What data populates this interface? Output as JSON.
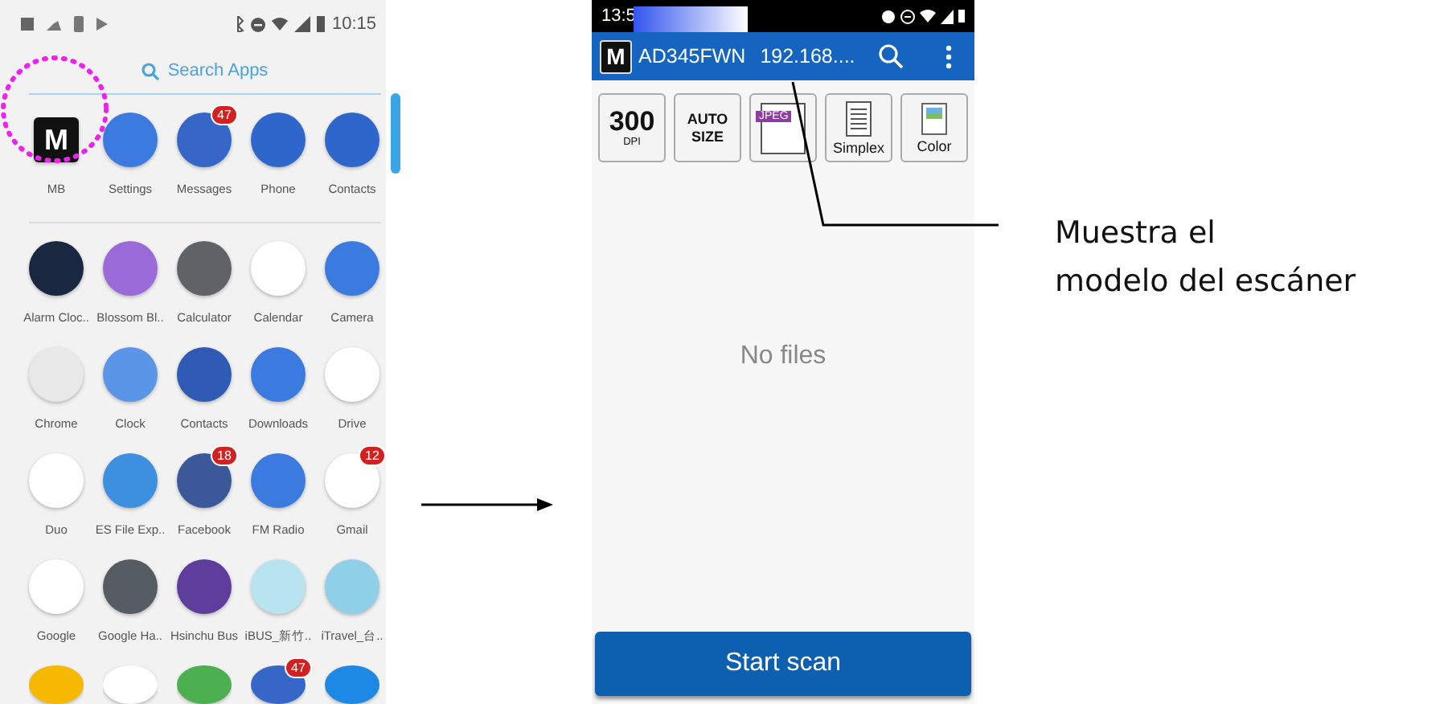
{
  "left_phone": {
    "status_bar": {
      "time": "10:15"
    },
    "search": {
      "placeholder": "Search Apps"
    },
    "favorites": [
      {
        "label": "MB",
        "logo": "M"
      },
      {
        "label": "Settings"
      },
      {
        "label": "Messages",
        "badge": "47"
      },
      {
        "label": "Phone"
      },
      {
        "label": "Contacts"
      }
    ],
    "apps": [
      {
        "label": "Alarm Cloc.."
      },
      {
        "label": "Blossom Bl.."
      },
      {
        "label": "Calculator"
      },
      {
        "label": "Calendar"
      },
      {
        "label": "Camera"
      },
      {
        "label": "Chrome"
      },
      {
        "label": "Clock"
      },
      {
        "label": "Contacts"
      },
      {
        "label": "Downloads"
      },
      {
        "label": "Drive"
      },
      {
        "label": "Duo"
      },
      {
        "label": "ES File Exp.."
      },
      {
        "label": "Facebook",
        "badge": "18"
      },
      {
        "label": "FM Radio"
      },
      {
        "label": "Gmail",
        "badge": "12"
      },
      {
        "label": "Google"
      },
      {
        "label": "Google Ha.."
      },
      {
        "label": "Hsinchu Bus"
      },
      {
        "label": "iBUS_新竹.."
      },
      {
        "label": "iTravel_台.."
      },
      {
        "kind": "partial"
      },
      {
        "kind": "partial"
      },
      {
        "kind": "partial"
      },
      {
        "kind": "partial",
        "badge": "47"
      },
      {
        "kind": "partial"
      }
    ]
  },
  "right_phone": {
    "status_bar": {
      "time": "13:5"
    },
    "toolbar": {
      "logo": "M",
      "model": "AD345FWN",
      "address": "192.168...."
    },
    "options": [
      {
        "kind": "dpi",
        "lines": [
          "300",
          "DPI"
        ]
      },
      {
        "kind": "text",
        "lines": [
          "AUTO",
          "SIZE"
        ]
      },
      {
        "kind": "format",
        "label": "JPEG"
      },
      {
        "kind": "sides",
        "label": "Simplex"
      },
      {
        "kind": "color",
        "label": "Color"
      }
    ],
    "empty_message": "No files",
    "start_button": "Start scan"
  },
  "annotation": {
    "lines": [
      "Muestra el",
      "modelo del escáner"
    ]
  }
}
